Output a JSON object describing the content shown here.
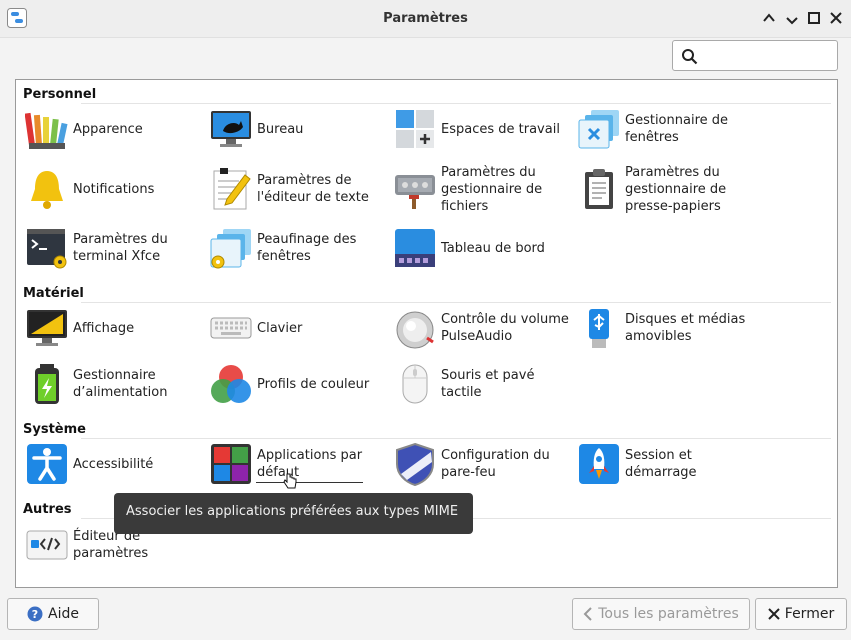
{
  "window": {
    "title": "Paramètres"
  },
  "search": {
    "placeholder": ""
  },
  "categories": [
    {
      "label": "Personnel",
      "items": [
        {
          "label": "Apparence",
          "icon": "appearance-palette-icon"
        },
        {
          "label": "Bureau",
          "icon": "desktop-icon"
        },
        {
          "label": "Espaces de travail",
          "icon": "workspaces-icon"
        },
        {
          "label": "Gestionnaire de fenêtres",
          "icon": "window-manager-icon"
        },
        {
          "label": "Notifications",
          "icon": "bell-icon"
        },
        {
          "label": "Paramètres de l'éditeur de texte",
          "icon": "text-editor-icon"
        },
        {
          "label": "Paramètres du gestionnaire de fichiers",
          "icon": "file-manager-icon"
        },
        {
          "label": "Paramètres du gestionnaire de presse-papiers",
          "icon": "clipboard-icon"
        },
        {
          "label": "Paramètres du terminal Xfce",
          "icon": "terminal-icon"
        },
        {
          "label": "Peaufinage des fenêtres",
          "icon": "window-tweaks-icon"
        },
        {
          "label": "Tableau de bord",
          "icon": "panel-icon"
        }
      ]
    },
    {
      "label": "Matériel",
      "items": [
        {
          "label": "Affichage",
          "icon": "display-icon"
        },
        {
          "label": "Clavier",
          "icon": "keyboard-icon"
        },
        {
          "label": "Contrôle du volume PulseAudio",
          "icon": "volume-knob-icon"
        },
        {
          "label": "Disques et médias amovibles",
          "icon": "usb-drive-icon"
        },
        {
          "label": "Gestionnaire d’alimentation",
          "icon": "battery-icon"
        },
        {
          "label": "Profils de couleur",
          "icon": "color-profiles-icon"
        },
        {
          "label": "Souris et pavé tactile",
          "icon": "mouse-icon"
        }
      ]
    },
    {
      "label": "Système",
      "items": [
        {
          "label": "Accessibilité",
          "icon": "accessibility-icon"
        },
        {
          "label": "Applications par défaut",
          "icon": "default-applications-icon"
        },
        {
          "label": "Configuration du pare-feu",
          "icon": "firewall-shield-icon"
        },
        {
          "label": "Session et démarrage",
          "icon": "rocket-icon"
        }
      ]
    },
    {
      "label": "Autres",
      "items": [
        {
          "label": "Éditeur de paramètres",
          "icon": "settings-editor-icon"
        }
      ]
    }
  ],
  "tooltip": {
    "text": "Associer les applications préférées aux types MIME"
  },
  "buttons": {
    "help": "Aide",
    "all_settings": "Tous les paramètres",
    "close": "Fermer"
  }
}
